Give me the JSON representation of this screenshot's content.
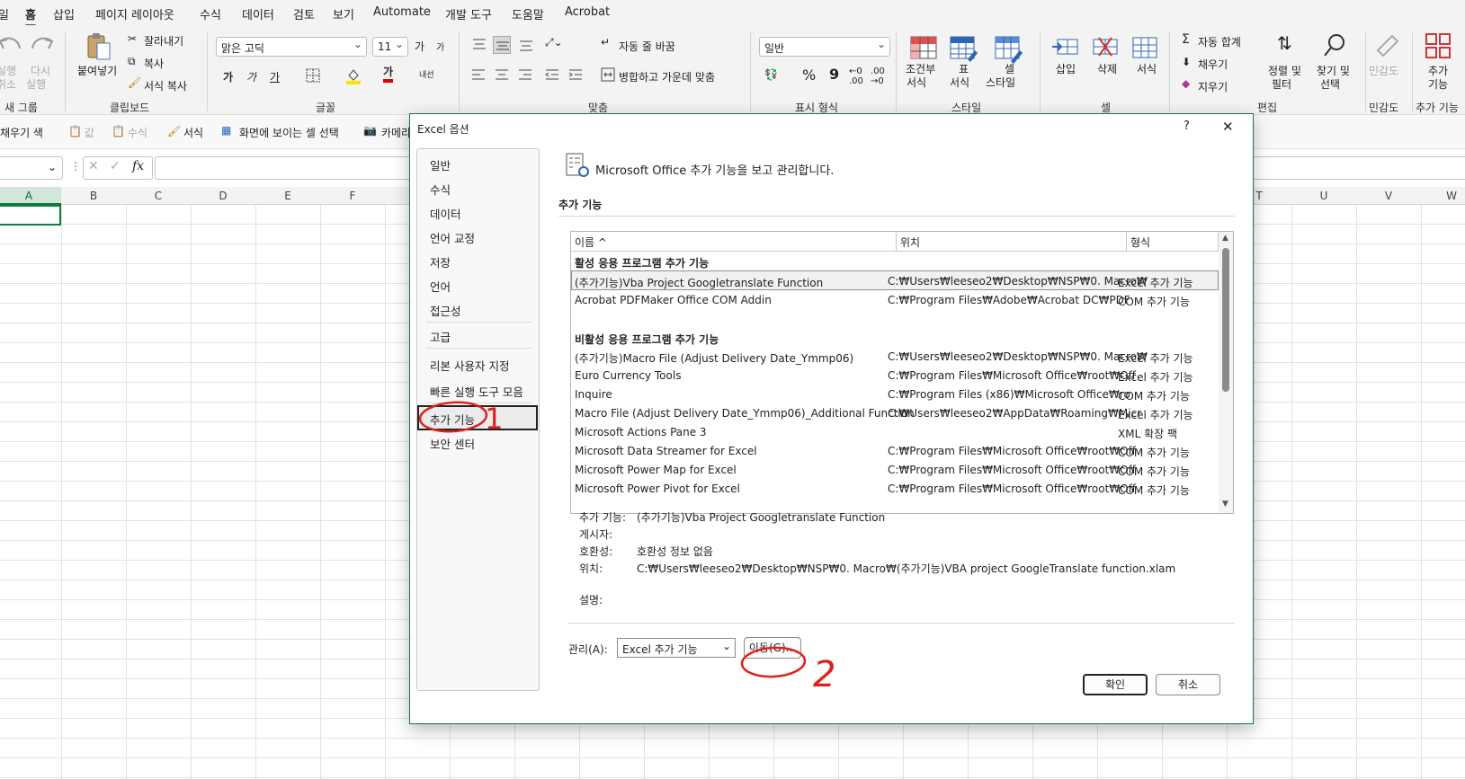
{
  "menu": {
    "items": [
      "일",
      "홈",
      "삽입",
      "페이지 레이아웃",
      "수식",
      "데이터",
      "검토",
      "보기",
      "Automate",
      "개발 도구",
      "도움말",
      "Acrobat"
    ],
    "active_index": 1
  },
  "ribbon": {
    "undo": {
      "line1": "실행",
      "line2": "취소"
    },
    "redo": {
      "line1": "다시",
      "line2": "실행"
    },
    "group_undo": "새 그룹",
    "paste": "붙여넣기",
    "cut": "잘라내기",
    "copy": "복사",
    "format_painter": "서식 복사",
    "group_clipboard": "클립보드",
    "font_name": "맑은 고딕",
    "font_size": "11",
    "grow": "가",
    "shrink": "가",
    "bold": "가",
    "italic": "가",
    "underline": "가",
    "font_color_glyph": "가",
    "phonetic": "내선",
    "group_font": "글꼴",
    "wrap_text": "자동 줄 바꿈",
    "merge": "병합하고 가운데 맞춤",
    "group_align": "맞춤",
    "num_format": "일반",
    "percent": "%",
    "comma": "9",
    "group_number": "표시 형식",
    "cond_format": {
      "line1": "조건부",
      "line2": "서식"
    },
    "table_format": {
      "line1": "표",
      "line2": "서식"
    },
    "cell_style": {
      "line1": "셀",
      "line2": "스타일"
    },
    "group_style": "스타일",
    "insert": "삽입",
    "delete": "삭제",
    "format": "서식",
    "group_cells": "셀",
    "autosum": "자동 합계",
    "fill": "채우기",
    "clear": "지우기",
    "sort_filter": {
      "line1": "정렬 및",
      "line2": "필터"
    },
    "find_select": {
      "line1": "찾기 및",
      "line2": "선택"
    },
    "group_edit": "편집",
    "sensitivity": "민감도",
    "group_sensitivity": "민감도",
    "addins": {
      "line1": "추가",
      "line2": "기능"
    },
    "group_addins": "추가 기능"
  },
  "qat": {
    "fill_color": "채우기 색",
    "values": "값",
    "formulas": "수식",
    "formats": "서식",
    "visible_cells": "화면에 보이는 셀 선택",
    "camera": "카메라"
  },
  "formula_bar": {
    "fx": "fx"
  },
  "columns_left": [
    "A",
    "B",
    "C",
    "D",
    "E",
    "F"
  ],
  "columns_right": [
    "T",
    "U",
    "V",
    "W"
  ],
  "dialog": {
    "title": "Excel 옵션",
    "help": "?",
    "close": "✕",
    "nav": [
      "일반",
      "수식",
      "데이터",
      "언어 교정",
      "저장",
      "언어",
      "접근성",
      "고급",
      "리본 사용자 지정",
      "빠른 실행 도구 모음",
      "추가 기능",
      "보안 센터"
    ],
    "nav_selected": 10,
    "header_text": "Microsoft Office 추가 기능을 보고 관리합니다.",
    "section_title": "추가 기능",
    "list": {
      "headers": [
        "이름 ^",
        "위치",
        "형식"
      ],
      "active_heading": "활성 응용 프로그램 추가 기능",
      "active_rows": [
        {
          "name": "(추가기능)Vba Project Googletranslate Function",
          "location": "C:₩Users₩leeseo2₩Desktop₩NSP₩0. Macro₩",
          "type": "Excel 추가 기능"
        },
        {
          "name": "Acrobat PDFMaker Office COM Addin",
          "location": "C:₩Program Files₩Adobe₩Acrobat DC₩PDF",
          "type": "COM 추가 기능"
        }
      ],
      "inactive_heading": "비활성 응용 프로그램 추가 기능",
      "inactive_rows": [
        {
          "name": "(추가기능)Macro File (Adjust Delivery Date_Ymmp06)",
          "location": "C:₩Users₩leeseo2₩Desktop₩NSP₩0. Macro₩",
          "type": "Excel 추가 기능"
        },
        {
          "name": "Euro Currency Tools",
          "location": "C:₩Program Files₩Microsoft Office₩root₩Off",
          "type": "Excel 추가 기능"
        },
        {
          "name": "Inquire",
          "location": "C:₩Program Files (x86)₩Microsoft Office₩ro",
          "type": "COM 추가 기능"
        },
        {
          "name": "Macro File (Adjust Delivery Date_Ymmp06)_Additional Function",
          "location": "C:₩Users₩leeseo2₩AppData₩Roaming₩Micr",
          "type": "Excel 추가 기능"
        },
        {
          "name": "Microsoft Actions Pane 3",
          "location": "",
          "type": "XML 확장 팩"
        },
        {
          "name": "Microsoft Data Streamer for Excel",
          "location": "C:₩Program Files₩Microsoft Office₩root₩Off",
          "type": "COM 추가 기능"
        },
        {
          "name": "Microsoft Power Map for Excel",
          "location": "C:₩Program Files₩Microsoft Office₩root₩Off",
          "type": "COM 추가 기능"
        },
        {
          "name": "Microsoft Power Pivot for Excel",
          "location": "C:₩Program Files₩Microsoft Office₩root₩Off",
          "type": "COM 추가 기능"
        }
      ]
    },
    "details": {
      "addin_label": "추가 기능:",
      "addin_value": "(추가기능)Vba Project Googletranslate Function",
      "publisher_label": "게시자:",
      "publisher_value": "",
      "compat_label": "호환성:",
      "compat_value": "호환성 정보 없음",
      "location_label": "위치:",
      "location_value": "C:₩Users₩leeseo2₩Desktop₩NSP₩0. Macro₩(추가기능)VBA project GoogleTranslate function.xlam",
      "desc_label": "설명:"
    },
    "manage_label": "관리(A):",
    "manage_value": "Excel 추가 기능",
    "go_button": "이동(G)...",
    "ok": "확인",
    "cancel": "취소"
  },
  "annotations": {
    "mark1": "1",
    "mark2": "2",
    "color": "#e0201a"
  },
  "colors": {
    "accent": "#107c41",
    "dialog_border": "#1e7145"
  }
}
